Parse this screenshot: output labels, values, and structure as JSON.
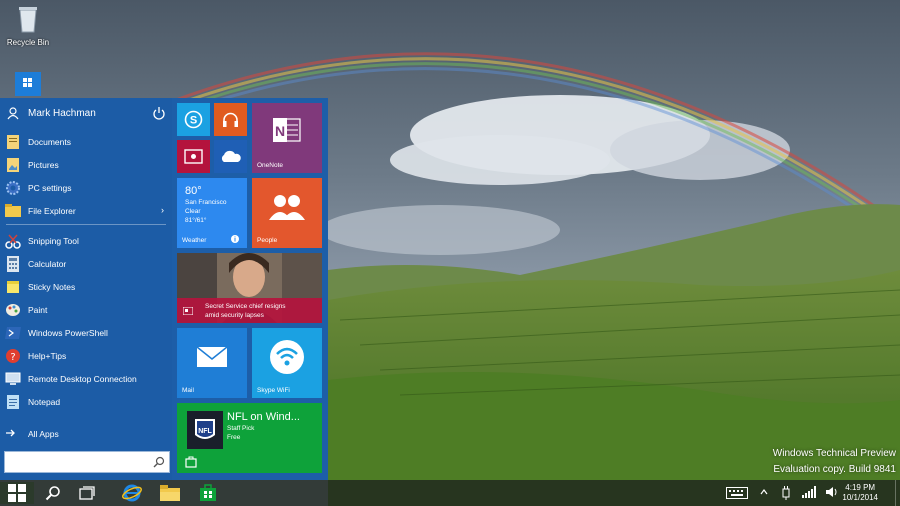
{
  "desktop": {
    "recycle_bin_label": "Recycle Bin"
  },
  "start_menu": {
    "user_name": "Mark Hachman",
    "pinned_items": [
      {
        "label": "Documents",
        "icon": "documents-icon"
      },
      {
        "label": "Pictures",
        "icon": "pictures-icon"
      },
      {
        "label": "PC settings",
        "icon": "gear-icon"
      },
      {
        "label": "File Explorer",
        "icon": "file-explorer-icon",
        "chevron": "›"
      }
    ],
    "recent_items": [
      {
        "label": "Snipping Tool",
        "icon": "snipping-tool-icon"
      },
      {
        "label": "Calculator",
        "icon": "calculator-icon"
      },
      {
        "label": "Sticky Notes",
        "icon": "sticky-notes-icon"
      },
      {
        "label": "Paint",
        "icon": "paint-icon"
      },
      {
        "label": "Windows PowerShell",
        "icon": "powershell-icon"
      },
      {
        "label": "Help+Tips",
        "icon": "help-icon"
      },
      {
        "label": "Remote Desktop Connection",
        "icon": "remote-desktop-icon"
      },
      {
        "label": "Notepad",
        "icon": "notepad-icon"
      }
    ],
    "all_apps_label": "All Apps",
    "search_placeholder": ""
  },
  "tiles": {
    "onenote_label": "OneNote",
    "weather": {
      "temp": "80°",
      "city": "San Francisco",
      "condition": "Clear",
      "range": "81°/61°",
      "label": "Weather"
    },
    "people_label": "People",
    "news_headline_1": "Secret Service chief resigns",
    "news_headline_2": "amid security lapses",
    "mail_label": "Mail",
    "skype_wifi_label": "Skype WiFi",
    "store": {
      "title": "NFL on Wind...",
      "sub1": "Staff Pick",
      "sub2": "Free"
    }
  },
  "colors": {
    "start_bg": "#1c5ca6",
    "skype": "#1ba1e2",
    "music": "#e05b1f",
    "video": "#b4133d",
    "onedrive": "#1f5fb5",
    "onenote": "#80397b",
    "weather": "#2d89ef",
    "people": "#e3572d",
    "mail": "#1f7ed6",
    "skype_wifi": "#1ba1e2",
    "store": "#0ea23a"
  },
  "taskbar": {
    "time": "4:19 PM",
    "date": "10/1/2014"
  },
  "watermark": {
    "line1": "Windows Technical Preview",
    "line2": "Evaluation copy. Build 9841"
  }
}
